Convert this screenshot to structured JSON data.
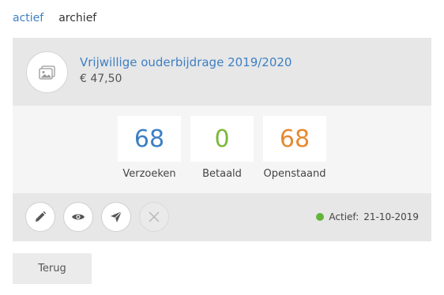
{
  "tabs": {
    "active": "actief",
    "archive": "archief"
  },
  "item": {
    "title": "Vrijwillige ouderbijdrage 2019/2020",
    "price": "€ 47,50",
    "image_icon": "image-placeholder-icon"
  },
  "stats": [
    {
      "value": "68",
      "label": "Verzoeken",
      "color": "#3d7fc4"
    },
    {
      "value": "0",
      "label": "Betaald",
      "color": "#7bb83a"
    },
    {
      "value": "68",
      "label": "Openstaand",
      "color": "#e8892f"
    }
  ],
  "actions": {
    "edit_icon": "pencil-icon",
    "view_icon": "eye-icon",
    "send_icon": "send-icon",
    "delete_icon": "close-icon"
  },
  "status": {
    "label": "Actief:",
    "date": "21-10-2019",
    "color": "#64b43c"
  },
  "footer": {
    "back_label": "Terug"
  }
}
